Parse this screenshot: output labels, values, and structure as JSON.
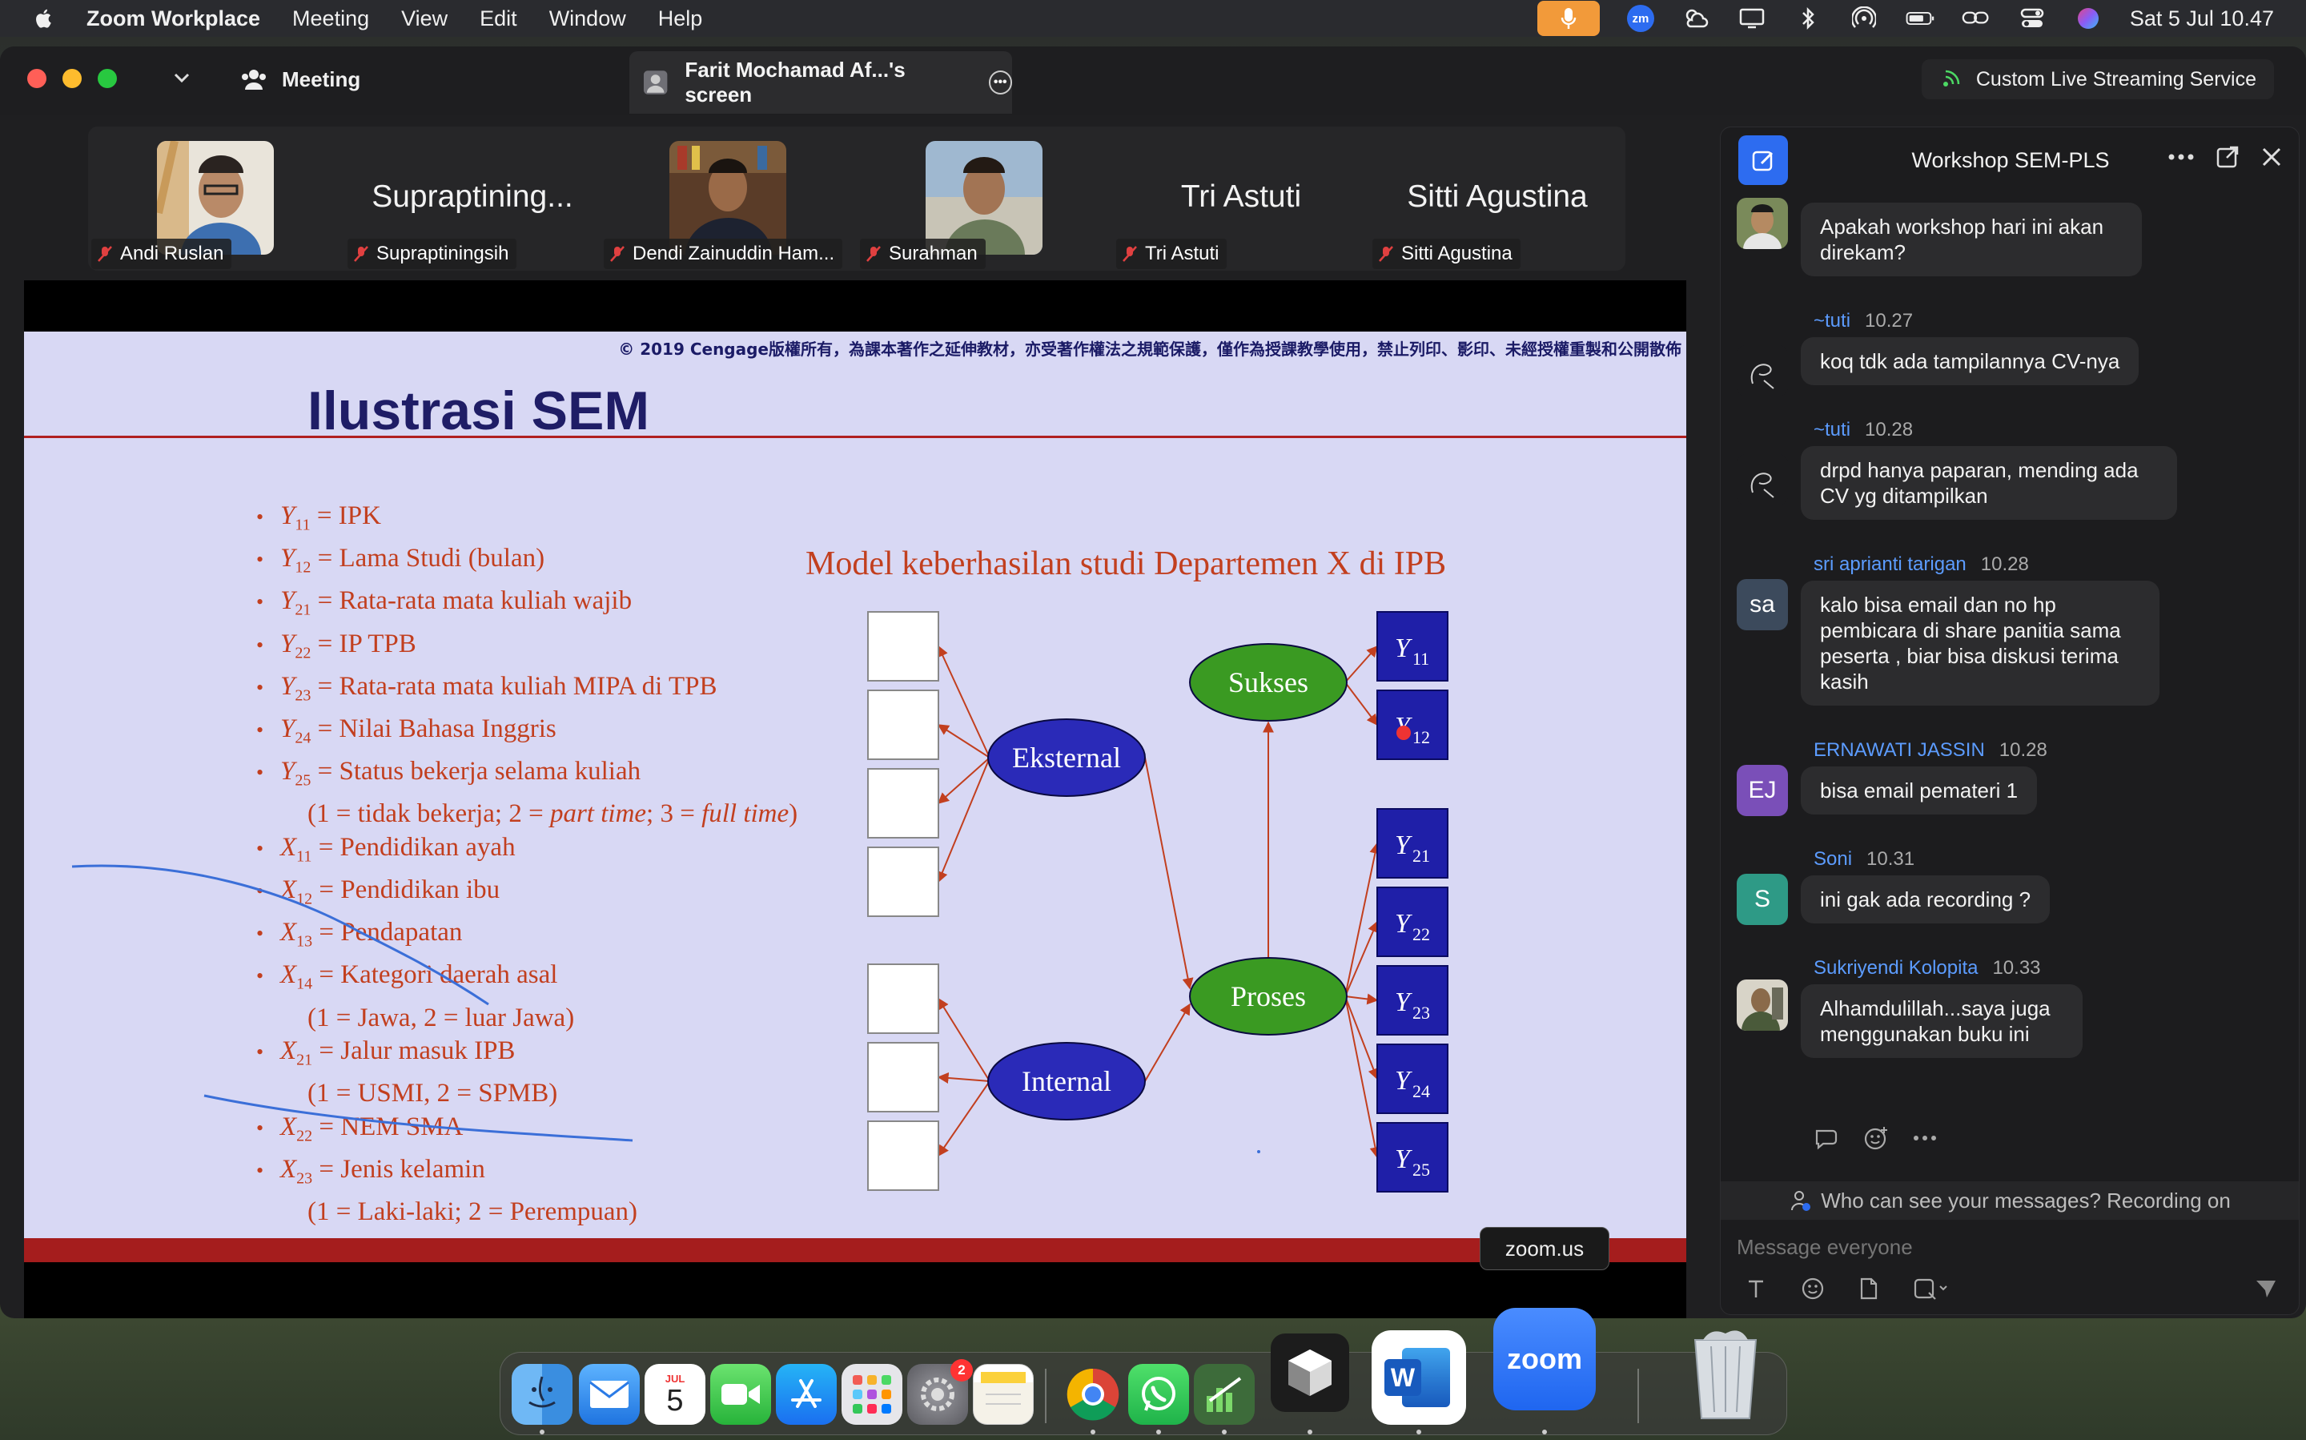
{
  "menubar": {
    "app_name": "Zoom Workplace",
    "items": [
      "Meeting",
      "View",
      "Edit",
      "Window",
      "Help"
    ],
    "clock": "Sat 5 Jul  10.47",
    "zoom_badge": "zm"
  },
  "window": {
    "meeting_tab": "Meeting",
    "share_tab": "Farit Mochamad Af...'s screen",
    "live_stream": "Custom Live Streaming Service"
  },
  "participants": [
    {
      "name": "Andi Ruslan",
      "display": "",
      "has_video": true
    },
    {
      "name": "Supraptiningsih",
      "display": "Supraptining...",
      "has_video": false
    },
    {
      "name": "Dendi Zainuddin Ham...",
      "display": "",
      "has_video": true
    },
    {
      "name": "Surahman",
      "display": "",
      "has_video": true
    },
    {
      "name": "Tri Astuti",
      "display": "Tri Astuti",
      "has_video": false
    },
    {
      "name": "Sitti Agustina",
      "display": "Sitti Agustina",
      "has_video": false
    }
  ],
  "slide": {
    "copyright": "© 2019 Cengage版權所有，為課本著作之延伸教材，亦受著作權法之規範保護，僅作為授課教學使用，禁止列印、影印、未經授權重製和公開散佈",
    "title": "Ilustrasi SEM",
    "bullets": [
      {
        "var": "Y",
        "sub": "11",
        "text": " = IPK"
      },
      {
        "var": "Y",
        "sub": "12",
        "text": " = Lama Studi (bulan)"
      },
      {
        "var": "Y",
        "sub": "21",
        "text": " = Rata-rata mata kuliah wajib"
      },
      {
        "var": "Y",
        "sub": "22",
        "text": " = IP TPB"
      },
      {
        "var": "Y",
        "sub": "23",
        "text": " = Rata-rata mata kuliah MIPA di TPB"
      },
      {
        "var": "Y",
        "sub": "24",
        "text": " = Nilai Bahasa Inggris"
      },
      {
        "var": "Y",
        "sub": "25",
        "text": " = Status bekerja selama kuliah"
      },
      {
        "var": "",
        "sub": "",
        "text": "(1 = tidak bekerja; 2 = ",
        "italic1": "part time",
        "mid": "; 3 = ",
        "italic2": "full time",
        "end": ")",
        "indent": true
      },
      {
        "var": "X",
        "sub": "11",
        "text": " = Pendidikan ayah"
      },
      {
        "var": "X",
        "sub": "12",
        "text": " = Pendidikan ibu"
      },
      {
        "var": "X",
        "sub": "13",
        "text": " = Pendapatan"
      },
      {
        "var": "X",
        "sub": "14",
        "text": " = Kategori daerah asal"
      },
      {
        "var": "",
        "sub": "",
        "text": "(1 = Jawa, 2 = luar Jawa)",
        "indent": true
      },
      {
        "var": "X",
        "sub": "21",
        "text": " = Jalur masuk IPB"
      },
      {
        "var": "",
        "sub": "",
        "text": "(1 = USMI, 2 = SPMB)",
        "indent": true
      },
      {
        "var": "X",
        "sub": "22",
        "text": " = NEM SMA"
      },
      {
        "var": "X",
        "sub": "23",
        "text": " = Jenis kelamin"
      },
      {
        "var": "",
        "sub": "",
        "text": "(1 = Laki-laki; 2 = Perempuan)",
        "indent": true
      }
    ],
    "model_title": "Model keberhasilan studi Departemen X di IPB",
    "latent": {
      "eksternal": "Eksternal",
      "internal": "Internal",
      "sukses": "Sukses",
      "proses": "Proses"
    },
    "indicators": [
      {
        "var": "Y",
        "sub": "11"
      },
      {
        "var": "Y",
        "sub": "12"
      },
      {
        "var": "Y",
        "sub": "21"
      },
      {
        "var": "Y",
        "sub": "22"
      },
      {
        "var": "Y",
        "sub": "23"
      },
      {
        "var": "Y",
        "sub": "24"
      },
      {
        "var": "Y",
        "sub": "25"
      }
    ]
  },
  "chat": {
    "title": "Workshop SEM-PLS",
    "messages": [
      {
        "sender": "",
        "time": "",
        "text": "Apakah workshop hari ini akan direkam?",
        "avatar": ""
      },
      {
        "sender": "~tuti",
        "time": "10.27",
        "text": "koq tdk ada tampilannya CV-nya",
        "avatar": ""
      },
      {
        "sender": "~tuti",
        "time": "10.28",
        "text": "drpd hanya paparan, mending ada CV yg ditampilkan",
        "avatar": ""
      },
      {
        "sender": "sri aprianti tarigan",
        "time": "10.28",
        "text": "kalo bisa email dan no hp pembicara di share panitia sama peserta , biar bisa diskusi terima kasih",
        "avatar": "sa"
      },
      {
        "sender": "ERNAWATI JASSIN",
        "time": "10.28",
        "text": "bisa email pemateri 1",
        "avatar": "EJ"
      },
      {
        "sender": "Soni",
        "time": "10.31",
        "text": "ini gak ada recording ?",
        "avatar": "S"
      },
      {
        "sender": "Sukriyendi Kolopita",
        "time": "10.33",
        "text": "Alhamdulillah...saya juga menggunakan buku ini",
        "avatar": ""
      }
    ],
    "privacy": "Who can see your messages? Recording on",
    "placeholder": "Message everyone"
  },
  "tooltip": "zoom.us",
  "dock": {
    "calendar_month": "JUL",
    "calendar_day": "5",
    "settings_badge": "2",
    "zoom_label": "zoom",
    "word_label": "W"
  }
}
